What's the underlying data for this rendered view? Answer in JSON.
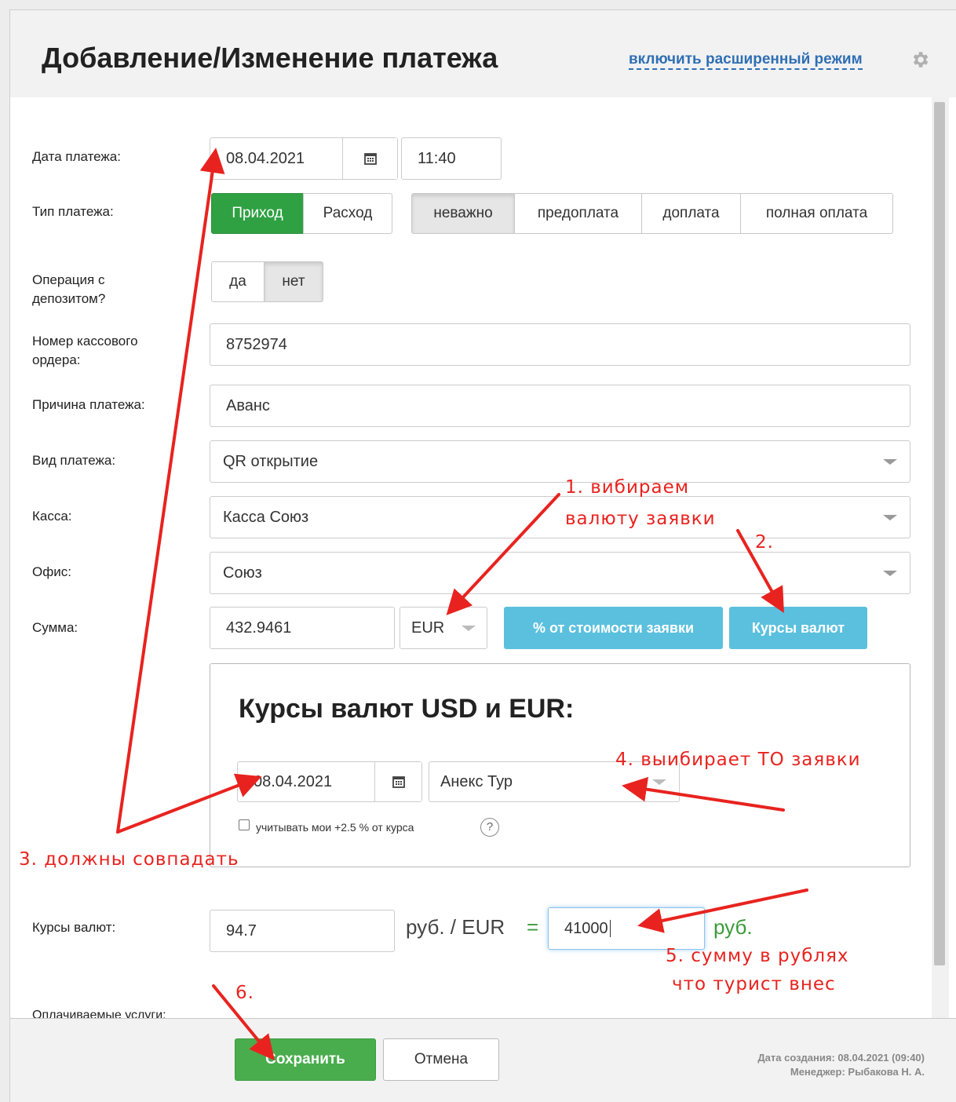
{
  "header": {
    "title": "Добавление/Изменение платежа",
    "advanced_link": "включить расширенный режим"
  },
  "form": {
    "date": {
      "label": "Дата платежа:",
      "value": "08.04.2021",
      "time": "11:40"
    },
    "type": {
      "label": "Тип платежа:",
      "direction": [
        "Приход",
        "Расход"
      ],
      "direction_active": "Приход",
      "kind": [
        "неважно",
        "предоплата",
        "доплата",
        "полная оплата"
      ],
      "kind_active": "неважно"
    },
    "deposit": {
      "label": "Операция с депозитом?",
      "options": [
        "да",
        "нет"
      ],
      "active": "нет"
    },
    "cash_order": {
      "label": "Номер кассового ордера:",
      "value": "8752974"
    },
    "reason": {
      "label": "Причина платежа:",
      "value": "Аванс"
    },
    "payment_kind": {
      "label": "Вид платежа:",
      "value": "QR открытие"
    },
    "cashbox": {
      "label": "Касса:",
      "value": "Касса Союз"
    },
    "office": {
      "label": "Офис:",
      "value": "Союз"
    },
    "sum": {
      "label": "Сумма:",
      "value": "432.9461",
      "currency": "EUR",
      "percent_button": "% от стоимости заявки",
      "rates_button": "Курсы валют"
    },
    "rates_box": {
      "title": "Курсы валют USD и EUR:",
      "date": "08.04.2021",
      "operator": "Анекс Тур",
      "checkbox_label": "учитывать мои +2.5 % от курса",
      "help": "?"
    },
    "rate": {
      "label": "Курсы валют:",
      "value": "94.7",
      "unit": "руб. / EUR",
      "equals": "=",
      "rub_value": "41000",
      "rub_unit": "руб."
    },
    "services_label": "Оплачиваемые услуги:"
  },
  "footer": {
    "save": "Сохранить",
    "cancel": "Отмена",
    "created": "Дата создания: 08.04.2021 (09:40)",
    "manager": "Менеджер: Рыбакова Н. А."
  },
  "annotations": {
    "a1_line1": "1. вибираем",
    "a1_line2": "валюту заявки",
    "a2": "2.",
    "a3": "3. должны совпадать",
    "a4": "4. выибирает ТО заявки",
    "a5_line1": "5. сумму в рублях",
    "a5_line2": "что турист внес",
    "a6": "6."
  },
  "colors": {
    "success": "#2fa143",
    "info": "#5bc0de",
    "link": "#2f6fb4",
    "annotation": "#e8231f"
  }
}
